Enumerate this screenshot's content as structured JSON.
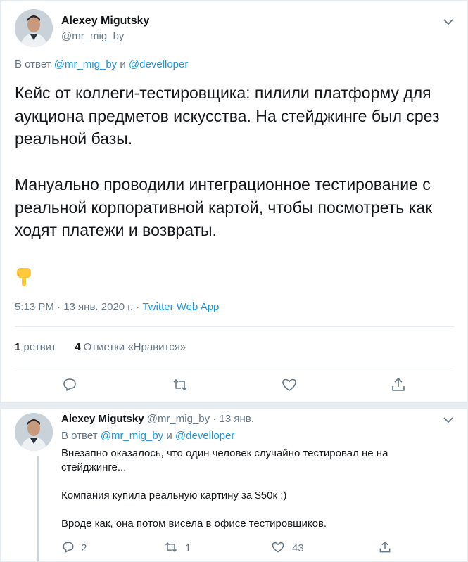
{
  "colors": {
    "link": "#1b95e0",
    "muted": "#657786",
    "text": "#14171a",
    "border": "#e6ecf0",
    "emoji": "#ffc83d"
  },
  "main_tweet": {
    "author_name": "Alexey Migutsky",
    "author_handle": "@mr_mig_by",
    "reply_prefix": "В ответ",
    "reply_user1": "@mr_mig_by",
    "reply_and": "и",
    "reply_user2": "@develloper",
    "text": "Кейс от коллеги-тестировщика: пилили платформу для аукциона предметов искусства. На стейджинге был срез реальной базы.\n\nМануально проводили интеграционное тестирование с реальной корпоративной картой, чтобы посмотреть как ходят платежи и возвраты.",
    "emoji": "pointing-down-hand",
    "time": "5:13 PM · 13 янв. 2020 г. · ",
    "source": "Twitter Web App",
    "retweet_count": "1",
    "retweet_label": "ретвит",
    "like_count": "4",
    "like_label": "Отметки «Нравится»",
    "actions": [
      "reply-icon",
      "retweet-icon",
      "like-icon",
      "share-icon"
    ]
  },
  "reply_tweet": {
    "author_name": "Alexey Migutsky",
    "author_handle": "@mr_mig_by",
    "date": "13 янв.",
    "reply_prefix": "В ответ",
    "reply_user1": "@mr_mig_by",
    "reply_and": "и",
    "reply_user2": "@develloper",
    "text": "Внезапно оказалось, что один человек случайно тестировал не на стейджинге...\n\nКомпания купила реальную картину за $50к :)\n\nВроде как, она потом висела в офисе тестировщиков.",
    "reply_count": "2",
    "retweet_count": "1",
    "like_count": "43"
  }
}
